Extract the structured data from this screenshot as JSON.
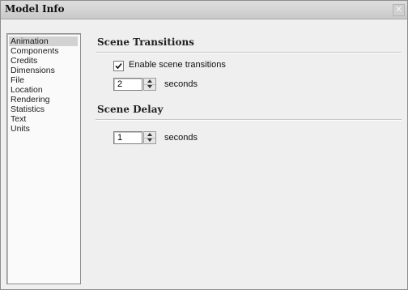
{
  "window": {
    "title": "Model Info",
    "close_icon": "close-icon"
  },
  "sidebar": {
    "items": [
      {
        "label": "Animation",
        "selected": true
      },
      {
        "label": "Components",
        "selected": false
      },
      {
        "label": "Credits",
        "selected": false
      },
      {
        "label": "Dimensions",
        "selected": false
      },
      {
        "label": "File",
        "selected": false
      },
      {
        "label": "Location",
        "selected": false
      },
      {
        "label": "Rendering",
        "selected": false
      },
      {
        "label": "Statistics",
        "selected": false
      },
      {
        "label": "Text",
        "selected": false
      },
      {
        "label": "Units",
        "selected": false
      }
    ]
  },
  "scene_transitions": {
    "title": "Scene Transitions",
    "enable_label": "Enable scene transitions",
    "enabled": true,
    "duration_value": "2",
    "unit_label": "seconds"
  },
  "scene_delay": {
    "title": "Scene Delay",
    "delay_value": "1",
    "unit_label": "seconds"
  },
  "colors": {
    "selected_item_bg": "#d2d2d2",
    "titlebar_bg": "#cfcfcf"
  }
}
